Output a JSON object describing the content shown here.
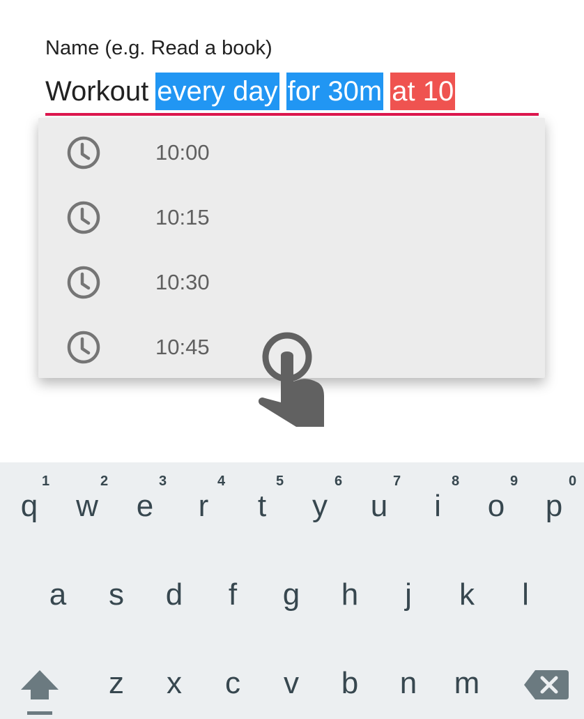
{
  "form": {
    "label": "Name (e.g. Read a book)",
    "text_plain": "Workout",
    "chip_frequency": "every day",
    "chip_duration": "for 30m",
    "chip_time": "at 10"
  },
  "suggestions": [
    {
      "icon": "clock-icon",
      "time": "10:00"
    },
    {
      "icon": "clock-icon",
      "time": "10:15"
    },
    {
      "icon": "clock-icon",
      "time": "10:30"
    },
    {
      "icon": "clock-icon",
      "time": "10:45"
    }
  ],
  "keyboard": {
    "row1": [
      "q",
      "w",
      "e",
      "r",
      "t",
      "y",
      "u",
      "i",
      "o",
      "p"
    ],
    "row1_hints": [
      "1",
      "2",
      "3",
      "4",
      "5",
      "6",
      "7",
      "8",
      "9",
      "0"
    ],
    "row2": [
      "a",
      "s",
      "d",
      "f",
      "g",
      "h",
      "j",
      "k",
      "l"
    ],
    "row3": [
      "z",
      "x",
      "c",
      "v",
      "b",
      "n",
      "m"
    ],
    "shift_icon": "shift-icon",
    "backspace_icon": "backspace-icon"
  },
  "colors": {
    "chip_blue": "#2196f3",
    "chip_red": "#ef5350",
    "underline": "#e0174f",
    "keyboard_bg": "#eceff1"
  }
}
